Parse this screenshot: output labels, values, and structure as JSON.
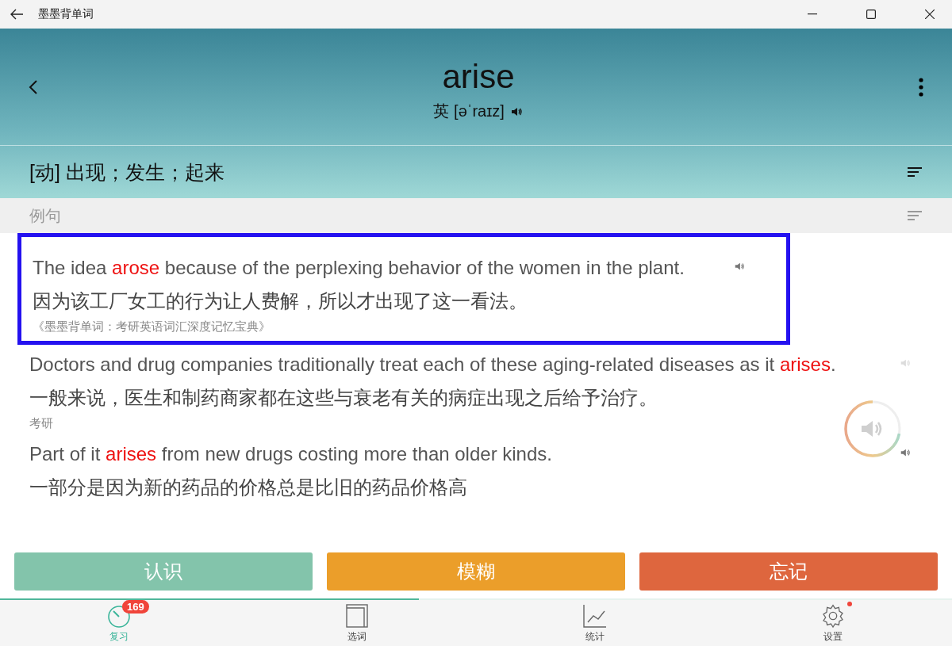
{
  "window": {
    "title": "墨墨背单词"
  },
  "word": {
    "text": "arise",
    "accent_label": "英",
    "phonetic": "[əˈraɪz]"
  },
  "definition": "[动] 出现；发生；起来",
  "examples_header": "例句",
  "examples": [
    {
      "selected": true,
      "speaker_dimmed": false,
      "en": [
        {
          "text": "The idea ",
          "highlight": false
        },
        {
          "text": "arose",
          "highlight": true
        },
        {
          "text": " because of the perplexing behavior of the women in the plant.",
          "highlight": false
        }
      ],
      "zh": "因为该工厂女工的行为让人费解，所以才出现了这一看法。",
      "source": "《墨墨背单词：考研英语词汇深度记忆宝典》"
    },
    {
      "selected": false,
      "speaker_dimmed": true,
      "en": [
        {
          "text": "Doctors and drug companies traditionally treat each of these aging-related diseases as it ",
          "highlight": false
        },
        {
          "text": "arises",
          "highlight": true
        },
        {
          "text": ".",
          "highlight": false
        }
      ],
      "zh": "一般来说，医生和制药商家都在这些与衰老有关的病症出现之后给予治疗。",
      "source": "考研"
    },
    {
      "selected": false,
      "speaker_dimmed": false,
      "en": [
        {
          "text": "Part of it ",
          "highlight": false
        },
        {
          "text": "arises",
          "highlight": true
        },
        {
          "text": " from new drugs costing more than older kinds.",
          "highlight": false
        }
      ],
      "zh": "一部分是因为新的药品的价格总是比旧的药品价格高"
    }
  ],
  "answers": [
    {
      "label": "认识",
      "kind": "know"
    },
    {
      "label": "模糊",
      "kind": "vague"
    },
    {
      "label": "忘记",
      "kind": "forget"
    }
  ],
  "progress": {
    "level": 0.44
  },
  "nav": [
    {
      "label": "复习",
      "selected": true,
      "badge": "169",
      "dot": false
    },
    {
      "label": "选词",
      "selected": false,
      "dot": false
    },
    {
      "label": "统计",
      "selected": false,
      "dot": false
    },
    {
      "label": "设置",
      "selected": false,
      "dot": true
    }
  ]
}
